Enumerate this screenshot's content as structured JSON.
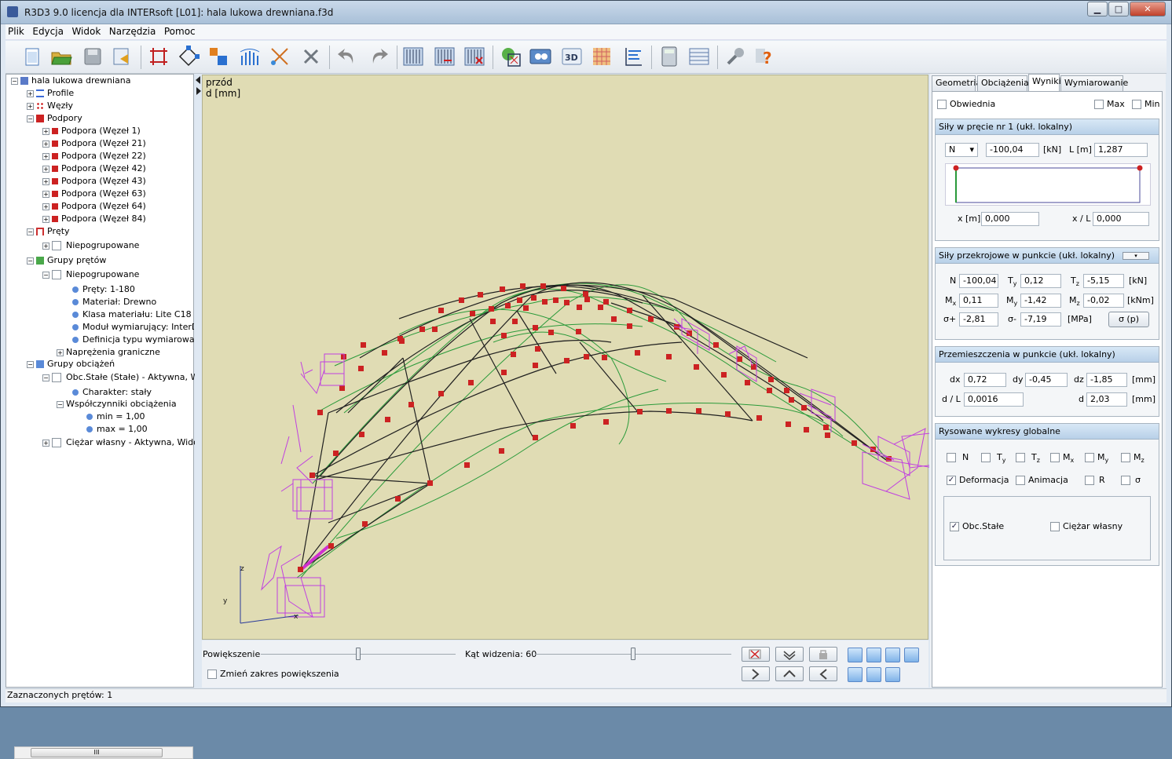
{
  "window": {
    "title": "R3D3 9.0 licencja dla INTERsoft [L01]: hala lukowa drewniana.f3d",
    "btn_min": "▁",
    "btn_max": "□",
    "btn_close": "✕"
  },
  "menu": [
    "Plik",
    "Edycja",
    "Widok",
    "Narzędzia",
    "Pomoc"
  ],
  "toolbar_icons": [
    "new-icon",
    "open-icon",
    "save-icon",
    "export-icon",
    "frame-icon",
    "node-icon",
    "copy-icon",
    "load-icon",
    "cut-icon",
    "delete-icon",
    "undo-icon",
    "redo-icon",
    "view-grid-icon",
    "view-edit-icon",
    "view-delete-icon",
    "calc-icon",
    "render-icon",
    "3d-icon",
    "grid-icon",
    "report-icon",
    "calculator-icon",
    "table-icon",
    "settings-icon",
    "help-icon"
  ],
  "toolbar_3d_label": "3D",
  "tree": {
    "root": "hala lukowa drewniana",
    "profile": "Profile",
    "nodes": "Węzły",
    "supports": "Podpory",
    "support_items": [
      "Podpora (Węzeł 1)",
      "Podpora (Węzeł 21)",
      "Podpora (Węzeł 22)",
      "Podpora (Węzeł 42)",
      "Podpora (Węzeł 43)",
      "Podpora (Węzeł 63)",
      "Podpora (Węzeł 64)",
      "Podpora (Węzeł 84)"
    ],
    "bars": "Pręty",
    "bars_ungrouped": "Niepogrupowane",
    "bar_groups": "Grupy prętów",
    "groups_ungrouped": "Niepogrupowane",
    "group_props": [
      "Pręty: 1-180",
      "Materiał: Drewno",
      "Klasa materiału: Lite C18",
      "Moduł wymiarujący: InterDrewno",
      "Definicja typu wymiarowania: "
    ],
    "limit_stresses": "Naprężenia graniczne",
    "load_groups": "Grupy obciążeń",
    "load_const": "Obc.Stałe (Stałe) - Aktywna, Widoczna",
    "character": "Charakter: stały",
    "load_factors": "Współczynniki obciążenia",
    "factor_min": "min = 1,00",
    "factor_max": "max = 1,00",
    "self_weight": "Ciężar własny - Aktywna, Widoczna",
    "scroll_label": "III"
  },
  "viewport": {
    "view_name": "przód",
    "result_label": "d [mm]",
    "axis_z": "z",
    "axis_y": "y",
    "axis_x": "x"
  },
  "bottom": {
    "zoom_label": "Powiększenie",
    "angle_label": "Kąt widzenia: 60",
    "zoom_range_label": "Zmień zakres powiększenia",
    "zoom_value": 0.5,
    "angle_value": 0.5
  },
  "tabs": [
    "Geometria",
    "Obciążenia",
    "Wyniki",
    "Wymiarowanie"
  ],
  "results": {
    "envelope": "Obwiednia",
    "max": "Max",
    "min": "Min",
    "bar_forces": {
      "title": "Siły w pręcie nr 1 (ukł. lokalny)",
      "select": "N",
      "value": "-100,04",
      "unit": "[kN]",
      "len_label": "L [m]",
      "len": "1,287",
      "x_label": "x [m]",
      "x": "0,000",
      "xl_label": "x / L",
      "xl": "0,000"
    },
    "section_forces": {
      "title": "Siły przekrojowe w punkcie (ukł. lokalny)",
      "N": "-100,04",
      "Ty": "0,12",
      "Tz": "-5,15",
      "unit_kn": "[kN]",
      "Mx": "0,11",
      "My": "-1,42",
      "Mz": "-0,02",
      "unit_knm": "[kNm]",
      "sp": "-2,81",
      "sm": "-7,19",
      "unit_mpa": "[MPa]",
      "sigma_btn": "σ (p)",
      "lbl_N": "N",
      "lbl_T": "T",
      "lbl_M": "M",
      "sub_x": "x",
      "sub_y": "y",
      "sub_z": "z",
      "lbl_sp": "σ+",
      "lbl_sm": "σ-"
    },
    "displacements": {
      "title": "Przemieszczenia w punkcie (ukł. lokalny)",
      "dx": "0,72",
      "dy": "-0,45",
      "dz": "-1,85",
      "unit": "[mm]",
      "dl": "0,0016",
      "d": "2,03",
      "lbl_dx": "dx",
      "lbl_dy": "dy",
      "lbl_dz": "dz",
      "lbl_dl": "d / L",
      "lbl_d": "d"
    },
    "global_plots": {
      "title": "Rysowane wykresy globalne",
      "lbl_N": "N",
      "lbl_T": "T",
      "lbl_M": "M",
      "sub_y": "y",
      "sub_z": "z",
      "sub_x": "x",
      "deformation": "Deformacja",
      "animation": "Animacja",
      "R": "R",
      "sigma": "σ",
      "load_const": "Obc.Stałe",
      "self_weight": "Ciężar własny",
      "check": "✓"
    }
  },
  "status": "Zaznaczonych prętów: 1",
  "colors": {
    "support": "#cc2222",
    "node": "#d02020",
    "deformed": "#2a9a3a",
    "structure": "#202020",
    "support_glyph": "#c040e0",
    "viewport_bg": "#e0dcb4"
  }
}
